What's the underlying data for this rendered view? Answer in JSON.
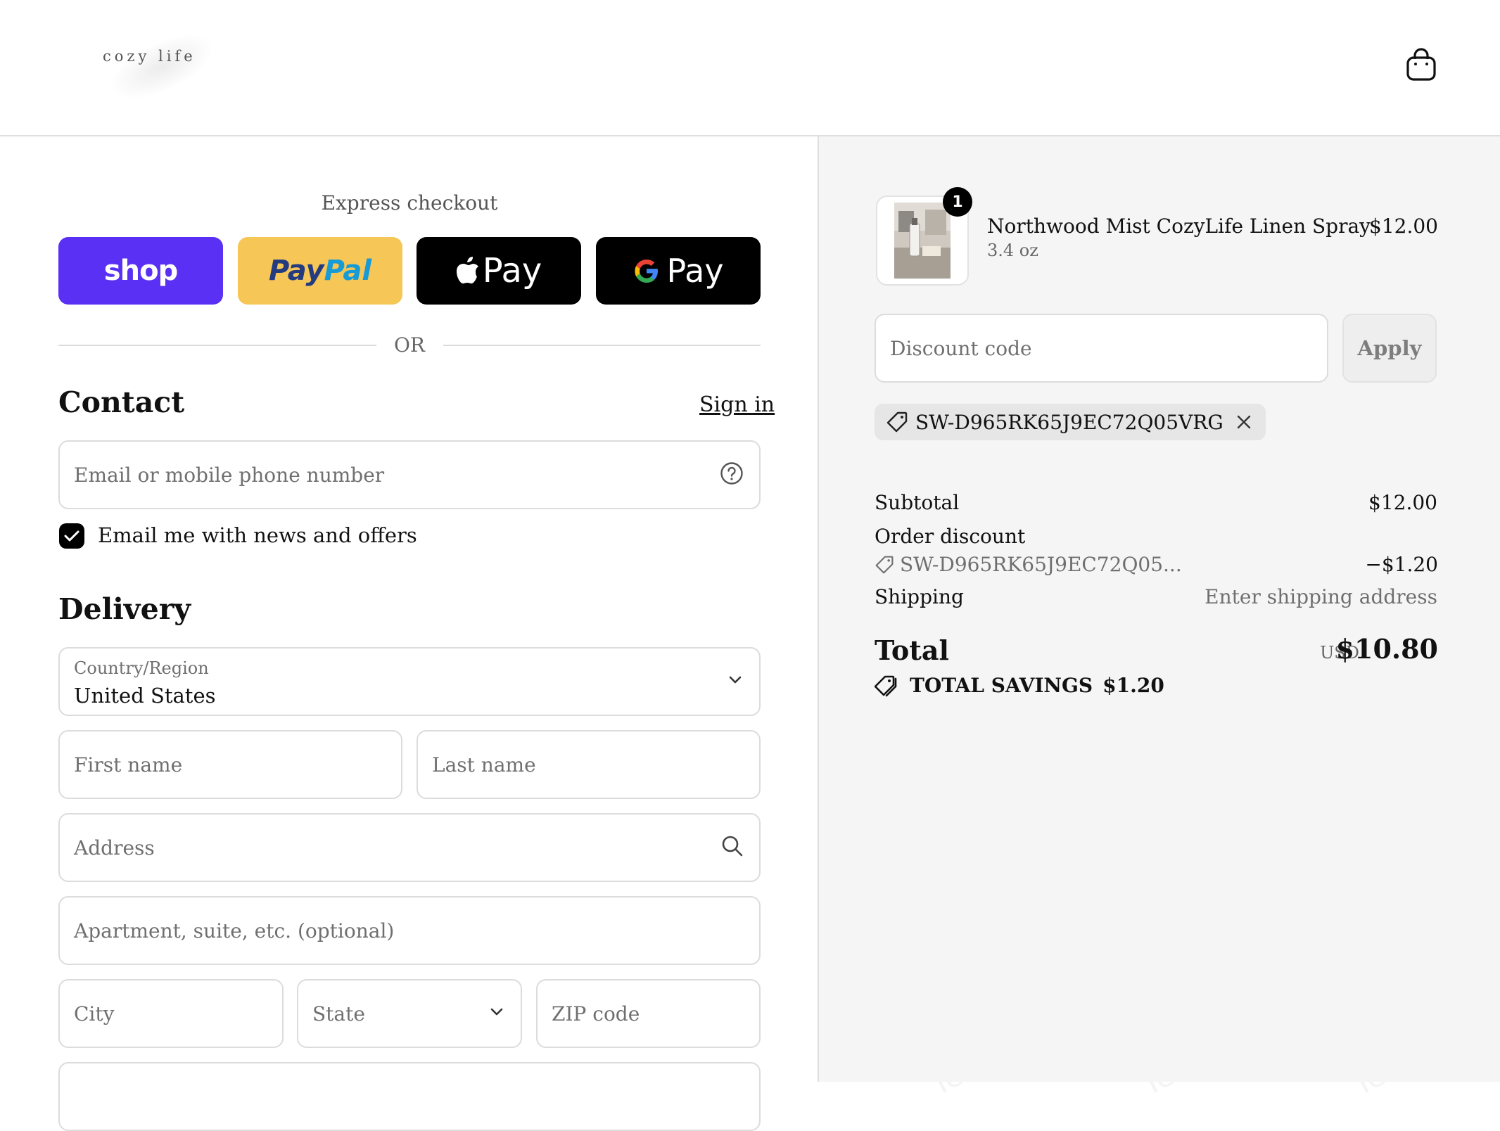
{
  "brand": {
    "logo_text": "cozy life"
  },
  "header": {
    "cart_icon": "shopping-bag-icon"
  },
  "express": {
    "label": "Express checkout",
    "buttons": [
      {
        "name": "shop-pay",
        "label": "shop"
      },
      {
        "name": "paypal",
        "label_part1": "Pay",
        "label_part2": "Pal"
      },
      {
        "name": "apple-pay",
        "label": "Pay"
      },
      {
        "name": "google-pay",
        "label": "Pay"
      }
    ],
    "or_label": "OR"
  },
  "contact": {
    "title": "Contact",
    "signin_label": "Sign in",
    "email_placeholder": "Email or mobile phone number",
    "newsletter_label": "Email me with news and offers",
    "newsletter_checked": true
  },
  "delivery": {
    "title": "Delivery",
    "country_label": "Country/Region",
    "country_value": "United States",
    "first_name_placeholder": "First name",
    "last_name_placeholder": "Last name",
    "address_placeholder": "Address",
    "apartment_placeholder": "Apartment, suite, etc. (optional)",
    "city_placeholder": "City",
    "state_placeholder": "State",
    "zip_placeholder": "ZIP code"
  },
  "order": {
    "item": {
      "quantity": "1",
      "name": "Northwood Mist CozyLife Linen Spray",
      "variant": "3.4 oz",
      "price": "$12.00"
    },
    "discount_placeholder": "Discount code",
    "apply_label": "Apply",
    "applied_code": "SW-D965RK65J9EC72Q05VRG",
    "subtotal_label": "Subtotal",
    "subtotal_value": "$12.00",
    "order_discount_label": "Order discount",
    "order_discount_code": "SW-D965RK65J9EC72Q05...",
    "order_discount_value": "−$1.20",
    "shipping_label": "Shipping",
    "shipping_value": "Enter shipping address",
    "total_label": "Total",
    "currency": "USD",
    "total_value": "$10.80",
    "savings_label": "TOTAL SAVINGS",
    "savings_value": "$1.20"
  },
  "colors": {
    "shop_pay": "#5a31f4",
    "paypal": "#f6c657",
    "apple_google": "#000000",
    "summary_bg": "#f5f5f5",
    "watermark_text": "Tenereteam"
  }
}
